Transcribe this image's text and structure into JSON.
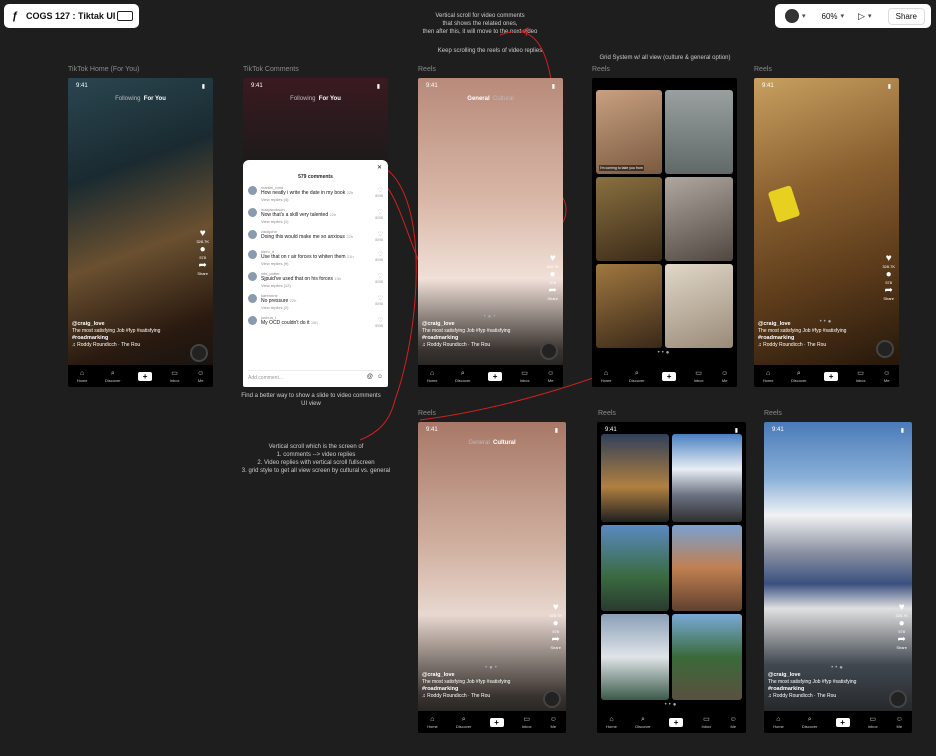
{
  "toolbar": {
    "file_title": "COGS 127 : Tiktak UI",
    "zoom": "60%",
    "share_label": "Share"
  },
  "labels": {
    "home": "TikTok Home (For You)",
    "comments": "TikTok Comments",
    "reels1": "Reels",
    "reels2": "Reels",
    "reels3": "Reels",
    "reels4": "Reels",
    "reels5": "Reels",
    "reels6": "Reels"
  },
  "notes": {
    "top1": "Vertical scroll for video comments",
    "top2": "that shows the related ones,",
    "top3": "then after this, it will move to the next video",
    "keep": "Keep scrolling the reels of video replies",
    "grid": "Grid System w/ all view (culture & general option)",
    "find1": "Find a better way to show a slide to video comments",
    "find2": "UI view",
    "vert1": "Vertical scroll which is the screen of",
    "vert2": "1. comments --> video replies",
    "vert3": "2. Video replies with vertical scroll fullscreen",
    "vert4": "3. grid style to get all view screen by cultural vs. general"
  },
  "phone": {
    "time": "9:41",
    "tab_following": "Following",
    "tab_foryou": "For You",
    "tab_general": "General",
    "tab_cultural": "Cultural",
    "user": "@craig_love",
    "caption1": "The most satisfying Job #fyp #satisfying",
    "caption2": "#roadmarking",
    "music": "Roddy Roundicch · The Rou",
    "likes": "328.7K",
    "comments_count": "578",
    "share": "Share"
  },
  "nav": {
    "home": "Home",
    "discover": "Discover",
    "inbox": "Inbox",
    "me": "Me"
  },
  "comments": {
    "header": "579 comments",
    "add_placeholder": "Add comment...",
    "items": [
      {
        "user": "martini_rond",
        "text": "How neatly i write the date in my book",
        "time": "22h",
        "replies": "View replies (4)",
        "likes": "8098"
      },
      {
        "user": "maxjacobson",
        "text": "Now that's a skill very talented",
        "time": "22h",
        "replies": "View replies (1)",
        "likes": "8098"
      },
      {
        "user": "zackjohn",
        "text": "Doing this would make me so anxious",
        "time": "22h",
        "replies": "",
        "likes": "8098"
      },
      {
        "user": "kiero_d",
        "text": "Use that on r air forces to whiten them",
        "time": "21h",
        "replies": "View replies (9)",
        "likes": "8098"
      },
      {
        "user": "mis_potter",
        "text": "Sjpuid've used that on his forces",
        "time": "13h",
        "replies": "View replies (12)",
        "likes": "8098"
      },
      {
        "user": "karennne",
        "text": "No pressure",
        "time": "22h",
        "replies": "View replies (2)",
        "likes": "8098"
      },
      {
        "user": "joshua_l",
        "text": "My OCD couldn't do it",
        "time": "15h",
        "replies": "",
        "likes": "8098"
      }
    ]
  },
  "grid_caption": "I'm coming to take you from"
}
